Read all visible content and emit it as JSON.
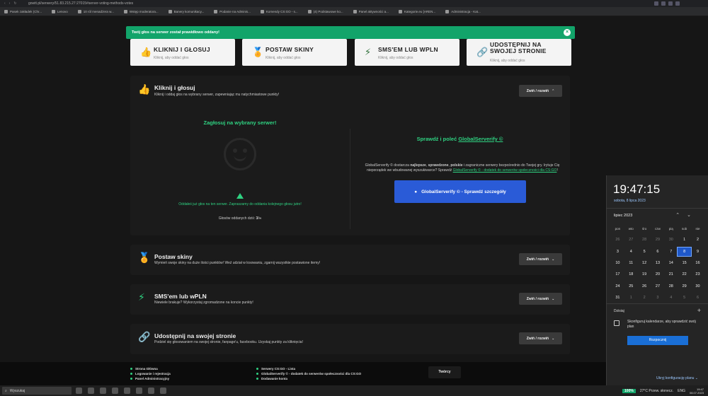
{
  "browser": {
    "url": "gowtt.pl/serwery/51.83.215.27:27015#server-voting-methods-votes"
  },
  "bookmarks": [
    "Pasek zakładek (Chr...",
    "Lenovo",
    "10 ról menadżera w...",
    "Wstęp moderatora...",
    "Banery komunikacy...",
    "Podanie na Adminis...",
    "Komendy CS:GO - s...",
    "(4) Podstawowe ko...",
    "Panel aktywności a...",
    "Kategorie.eu [AREN...",
    "Administracja - Kat..."
  ],
  "toast": {
    "text": "Twój głos na serwer został prawidłowo oddany!",
    "close": "×"
  },
  "top_cards": [
    {
      "title": "KLIKNIJ I GŁOSUJ",
      "subtitle": "Kliknij, aby oddać głos",
      "icon": "thumbs-up-icon"
    },
    {
      "title": "POSTAW SKINY",
      "subtitle": "Kliknij, aby oddać głos",
      "icon": "medal-icon"
    },
    {
      "title": "SMS'EM LUB WPLN",
      "subtitle": "Kliknij, aby oddać głos",
      "icon": "bolt-icon"
    },
    {
      "title": "UDOSTĘPNIJ NA SWOJEJ STRONIE",
      "subtitle": "Kliknij, aby oddać głos",
      "icon": "link-icon"
    }
  ],
  "panels": {
    "click_vote": {
      "title": "Kliknij i głosuj",
      "desc": "Kliknij i oddaj głos na wybrany serwer, zapewniając mu natychmiastowe punkty!",
      "toggle": "Zwiń / rozwiń",
      "left_heading": "Zagłosuj na wybrany serwer!",
      "voted_msg": "Oddałeś już głos na ten serwer. Zapraszamy do oddania kolejnego głosu jutro!",
      "votes_label": "Głosów oddanych dziś:",
      "votes_value": "3/∞",
      "right_heading_prefix": "Sprawdź i poleć ",
      "right_heading_link": "GlobalServerify ©",
      "gs_desc_1": "GlobalServerify © dostarcza ",
      "gs_desc_b1": "najlepsze",
      "gs_desc_2": ", ",
      "gs_desc_b2": "sprawdzone",
      "gs_desc_3": ", ",
      "gs_desc_b3": "polskie",
      "gs_desc_4": " i zagraniczne serwery bezpośrednio do Twojej gry. Irytuje Cię nieporządek we wbudowanej wyszukiwarce? Sprawdź ",
      "gs_desc_link": "GlobalServerify © - dodatek do serwerów społeczności dla CS:GO",
      "gs_desc_5": "!",
      "gs_button": "GlobalServerify © - Sprawdź szczegóły"
    },
    "skins": {
      "title": "Postaw skiny",
      "desc": "Wymień swoje skiny na duże ilości punktów! Weź udział w losowaniu, zgarnij wszystkie postawione itemy!",
      "toggle": "Zwiń / rozwiń"
    },
    "sms": {
      "title": "SMS'em lub wPLN",
      "desc": "Niewiele brakuje? Wykorzystaj zgromadzone na koncie punkty!",
      "toggle": "Zwiń / rozwiń"
    },
    "share": {
      "title": "Udostępnij na swojej stronie",
      "desc": "Podziel się głosowaniem na swojej stronie, fanpage'u, facebooku. Uzyskaj punkty za kliknięcia!",
      "toggle": "Zwiń / rozwiń"
    }
  },
  "footer": {
    "col1": [
      "Strona Główna",
      "Logowanie i rejestracja",
      "Panel Administracyjny"
    ],
    "col2": [
      "Serwery CS:GO - Lista",
      "GlobalServerify © - dodatek do serwerów społeczności dla CS:GO",
      "Dodawanie konta"
    ],
    "contact": "Twórcy"
  },
  "calendar": {
    "time": "19:47:15",
    "date": "sobota, 8 lipca 2023",
    "month": "lipiec 2023",
    "weekdays": [
      "pon",
      "wto",
      "śro",
      "czw",
      "pią",
      "sob",
      "nie"
    ],
    "weeks": [
      [
        "26",
        "27",
        "28",
        "29",
        "30",
        "1",
        "2"
      ],
      [
        "3",
        "4",
        "5",
        "6",
        "7",
        "8",
        "9"
      ],
      [
        "10",
        "11",
        "12",
        "13",
        "14",
        "15",
        "16"
      ],
      [
        "17",
        "18",
        "19",
        "20",
        "21",
        "22",
        "23"
      ],
      [
        "24",
        "25",
        "26",
        "27",
        "28",
        "29",
        "30"
      ],
      [
        "31",
        "1",
        "2",
        "3",
        "4",
        "5",
        "6"
      ]
    ],
    "selected_day": "8",
    "today_label": "Dzisiaj",
    "setup_text": "Skonfiguruj kalendarze, aby sprawdzić swój plan",
    "start_button": "Rozpocznij",
    "hide_link": "Ukryj konfigurację planu"
  },
  "taskbar": {
    "search": "Wyszukaj",
    "battery": "100%",
    "weather": "27°C  Przew. słonecz.",
    "lang": "ENG",
    "clock_time": "19:47",
    "clock_date": "08.07.2023"
  }
}
